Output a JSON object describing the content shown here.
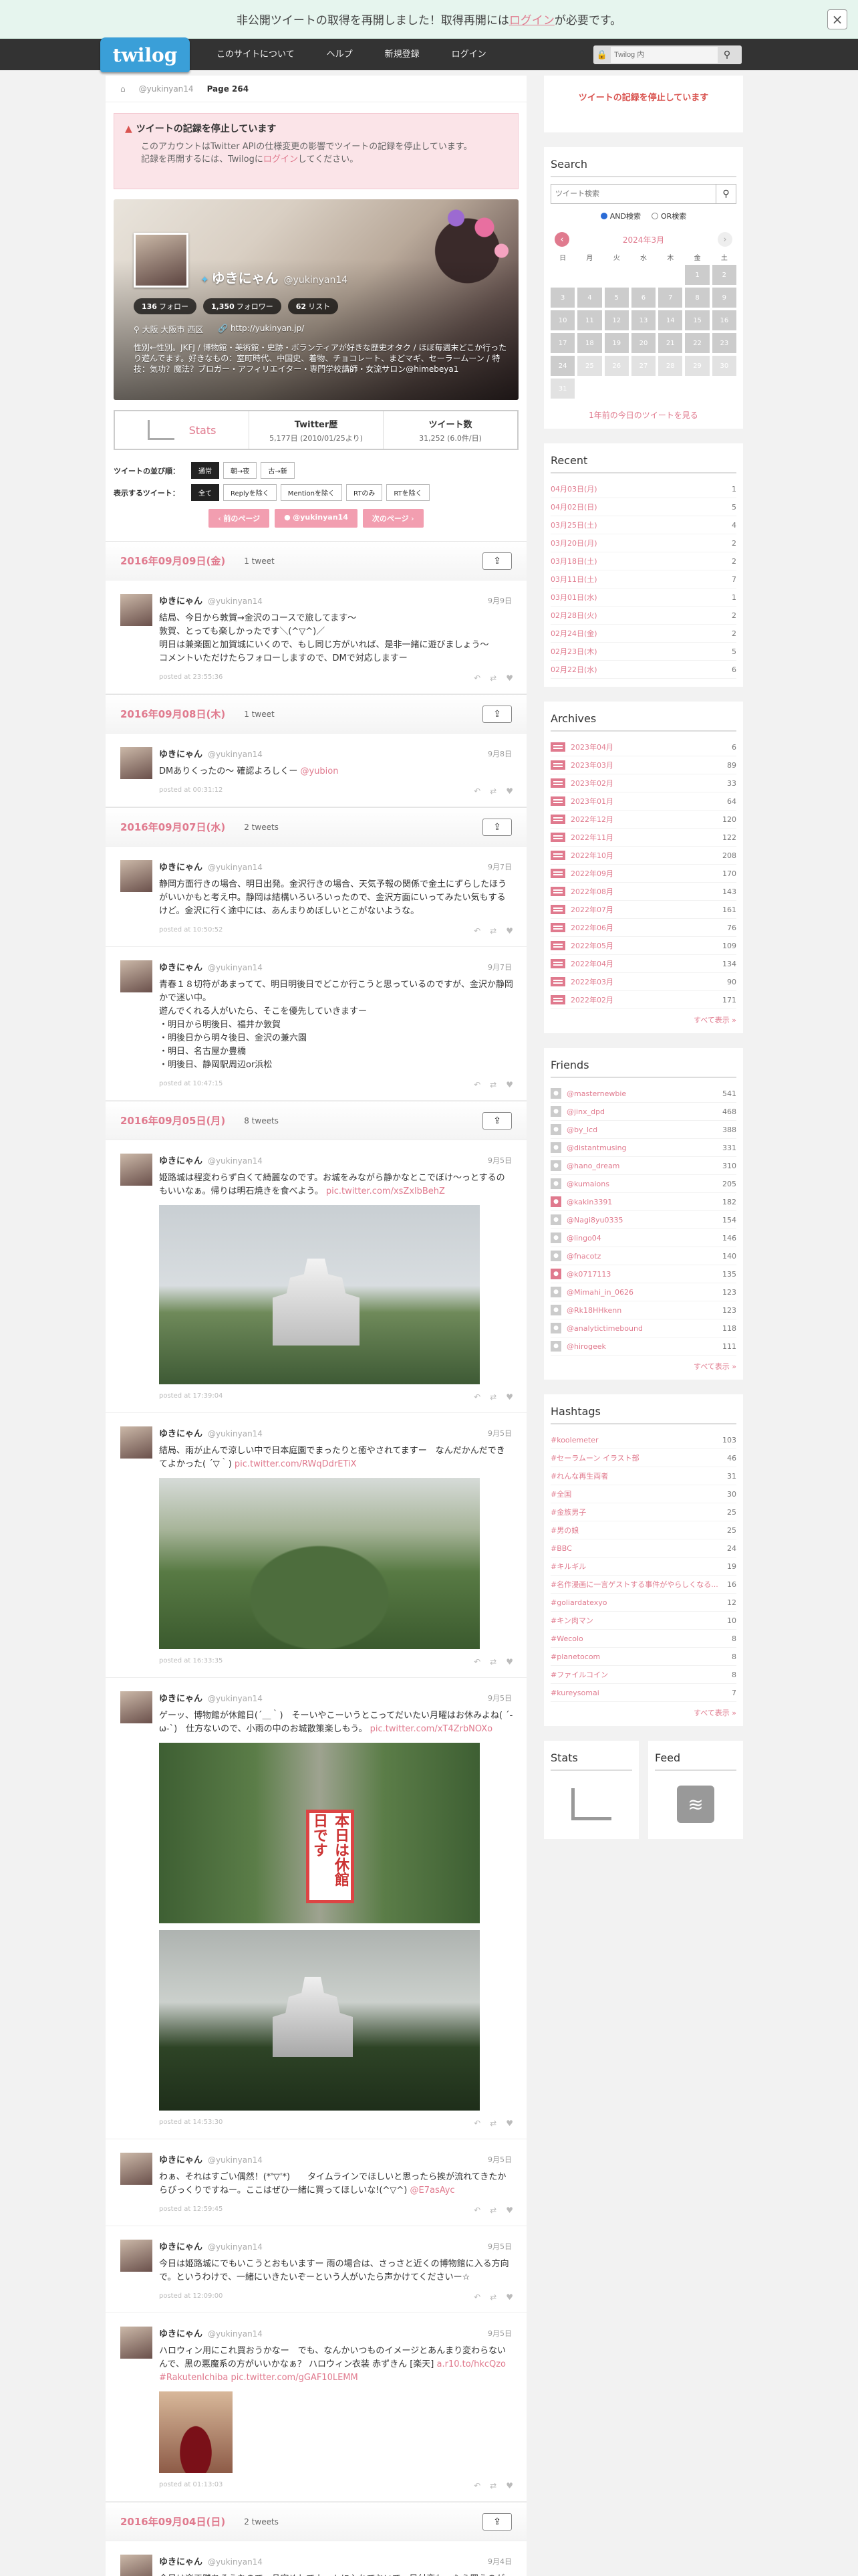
{
  "notice": {
    "text_before": "非公開ツイートの取得を再開しました！取得再開には",
    "link": "ログイン",
    "text_after": "が必要です。",
    "close": "×"
  },
  "header": {
    "logo": "twilog",
    "nav": [
      "このサイトについて",
      "ヘルプ",
      "新規登録",
      "ログイン"
    ],
    "search_placeholder": "Twilog 内",
    "search_icon": "search-icon"
  },
  "breadcrumb": {
    "user": "@yukinyan14",
    "page": "Page 264"
  },
  "warning": {
    "title": "ツイートの記録を停止しています",
    "line1": "このアカウントはTwitter APIの仕様変更の影響でツイートの記録を停止しています。",
    "line2_before": "記録を再開するには、Twilogに",
    "line2_link": "ログイン",
    "line2_after": "してください。"
  },
  "profile": {
    "name": "ゆきにゃん",
    "handle": "@yukinyan14",
    "follow": "136",
    "follow_label": "フォロー",
    "follower": "1,350",
    "follower_label": "フォロワー",
    "list": "62",
    "list_label": "リスト",
    "location": "大阪 大阪市 西区",
    "url": "http://yukinyan.jp/",
    "bio": "性別←性別。JKFJ / 博物館・美術館・史跡・ボランティアが好きな歴史オタク / ほぼ毎週末どこか行ったり遊んでます。好きなもの：室町時代、中国史、着物、チョコレート、まどマギ、セーラームーン / 特技：気功？魔法？ブロガー・アフィリエイター・専門学校講師・女流サロン@himebeya1"
  },
  "stats": {
    "label": "Stats",
    "twitter_title": "Twitter歴",
    "twitter_value": "5,177日",
    "twitter_since": "(2010/01/25より)",
    "tweets_title": "ツイート数",
    "tweets_value": "31,252",
    "tweets_per": "(6.0件/日)"
  },
  "selectors": {
    "order_label": "ツイートの並び順：",
    "order": [
      "通常",
      "朝→夜",
      "古→新"
    ],
    "filter_label": "表示するツイート：",
    "filter": [
      "全て",
      "Replyを除く",
      "Mentionを除く",
      "RTのみ",
      "RTを除く"
    ]
  },
  "pager": [
    "前のページ",
    "@yukinyan14",
    "次のページ"
  ],
  "days": [
    {
      "date": "2016年09月09日(金)",
      "count": "1 tweet",
      "tweets": [
        {
          "name": "ゆきにゃん",
          "handle": "@yukinyan14",
          "time": "9月9日",
          "text": "結局、今日から敦賀→金沢のコースで旅してます〜\n敦賀、とっても楽しかったです＼(^▽^)／\n明日は兼楽園と加賀城にいくので、もし同じ方がいれば、是非一緒に遊びましょう〜\nコメントいただけたらフォローしますので、DMで対応しますー",
          "link": "",
          "posted": "posted at 23:55:36"
        }
      ]
    },
    {
      "date": "2016年09月08日(木)",
      "count": "1 tweet",
      "tweets": [
        {
          "name": "ゆきにゃん",
          "handle": "@yukinyan14",
          "time": "9月8日",
          "text": "DMありくったの〜 確認よろしくー",
          "link": "@yubion",
          "posted": "posted at 00:31:12"
        }
      ]
    },
    {
      "date": "2016年09月07日(水)",
      "count": "2 tweets",
      "tweets": [
        {
          "name": "ゆきにゃん",
          "handle": "@yukinyan14",
          "time": "9月7日",
          "text": "静岡方面行きの場合、明日出発。金沢行きの場合、天気予報の関係で金土にずらしたほうがいいかもと考え中。静岡は結構いろいろいったので、金沢方面にいってみたい気もするけど。金沢に行く途中には、あんまりめぼしいとこがないような。",
          "link": "",
          "posted": "posted at 10:50:52"
        },
        {
          "name": "ゆきにゃん",
          "handle": "@yukinyan14",
          "time": "9月7日",
          "text": "青春１８切符があまってて、明日明後日でどこか行こうと思っているのですが、金沢か静岡かで迷い中。\n遊んでくれる人がいたら、そこを優先していきますー\n・明日から明後日、福井か敦賀\n・明後日から明々後日、金沢の兼六園\n・明日、名古屋か豊橋\n・明後日、静岡駅周辺or浜松",
          "link": "",
          "posted": "posted at 10:47:15"
        }
      ]
    },
    {
      "date": "2016年09月05日(月)",
      "count": "8 tweets",
      "tweets": [
        {
          "name": "ゆきにゃん",
          "handle": "@yukinyan14",
          "time": "9月5日",
          "text": "姫路城は程変わらず白くて綺麗なのです。お城をみながら静かなとこでぼけ〜っとするのもいいなぁ。帰りは明石焼きを食べよう。",
          "link": "pic.twitter.com/xsZxlbBehZ",
          "posted": "posted at 17:39:04"
        },
        {
          "name": "ゆきにゃん",
          "handle": "@yukinyan14",
          "time": "9月5日",
          "text": "結局、雨が止んで涼しい中で日本庭園でまったりと癒やされてますー　なんだかんだできてよかった( ´▽｀)",
          "link": "pic.twitter.com/RWqDdrETiX",
          "posted": "posted at 16:33:35"
        },
        {
          "name": "ゆきにゃん",
          "handle": "@yukinyan14",
          "time": "9月5日",
          "text": "ゲーッ、博物館が休館日(´＿｀)　そーいやこーいうとこってだいたい月曜はお休みよね( ´-ω-`)　仕方ないので、小雨の中のお城散策楽しもう。",
          "link": "pic.twitter.com/xT4ZrbNOXo",
          "posted": "posted at 14:53:30"
        },
        {
          "name": "ゆきにゃん",
          "handle": "@yukinyan14",
          "time": "9月5日",
          "text": "わぁ、それはすごい偶然！(*'▽'*)　　タイムラインでほしいと思ったら挨が流れてきたからびっくりですねー。ここはぜひ一緒に買ってほしいな!(^▽^)",
          "link": "@E7asAyc",
          "posted": "posted at 12:59:45"
        },
        {
          "name": "ゆきにゃん",
          "handle": "@yukinyan14",
          "time": "9月5日",
          "text": "今日は姫路城にでもいこうとおもいますー 雨の場合は、さっさと近くの博物館に入る方向で。というわけで、一緒にいきたいぞーという人がいたら声かけてくださいー☆",
          "link": "",
          "posted": "posted at 12:09:00"
        },
        {
          "name": "ゆきにゃん",
          "handle": "@yukinyan14",
          "time": "9月5日",
          "text": "ハロウィン用にこれ買おうかなー　でも、なんかいつものイメージとあんまり変わらないんで、黒の悪魔系の方がいいかなぁ？ ハロウィン衣装 赤ずきん [楽天]",
          "link": "a.r10.to/hkcQzo #RakutenIchiba pic.twitter.com/gGAF10LEMM",
          "posted": "posted at 01:13:03"
        }
      ]
    },
    {
      "date": "2016年09月04日(日)",
      "count": "2 tweets",
      "tweets": [
        {
          "name": "ゆきにゃん",
          "handle": "@yukinyan14",
          "time": "9月4日",
          "text": "今日は楽天勝ちそうなので、品定めしてカートに入れておいて、日付変わったら買うのが懸命かな。しかし、１０店舗も買いまわりできるかというとビミョーではあ",
          "link": "",
          "posted": ""
        }
      ]
    }
  ],
  "photos": {
    "sign_text": "本日は休館日です"
  },
  "side": {
    "stopped": "ツイートの記録を停止しています",
    "search_title": "Search",
    "search_placeholder": "ツイート検索",
    "and": "AND検索",
    "or": "OR検索",
    "cal_month": "2024年3月",
    "weekdays": [
      "日",
      "月",
      "火",
      "水",
      "木",
      "金",
      "土"
    ],
    "days": [
      "",
      "",
      "",
      "",
      "",
      "1",
      "2",
      "3",
      "4",
      "5",
      "6",
      "7",
      "8",
      "9",
      "10",
      "11",
      "12",
      "13",
      "14",
      "15",
      "16",
      "17",
      "18",
      "19",
      "20",
      "21",
      "22",
      "23",
      "24",
      "25",
      "26",
      "27",
      "28",
      "29",
      "30",
      "31"
    ],
    "year_link": "1年前の今日のツイートを見る",
    "recent_title": "Recent",
    "recent": [
      [
        "04月03日(月)",
        "1"
      ],
      [
        "04月02日(日)",
        "5"
      ],
      [
        "03月25日(土)",
        "4"
      ],
      [
        "03月20日(月)",
        "2"
      ],
      [
        "03月18日(土)",
        "2"
      ],
      [
        "03月11日(土)",
        "7"
      ],
      [
        "03月01日(水)",
        "1"
      ],
      [
        "02月28日(火)",
        "2"
      ],
      [
        "02月24日(金)",
        "2"
      ],
      [
        "02月23日(木)",
        "5"
      ],
      [
        "02月22日(水)",
        "6"
      ]
    ],
    "archives_title": "Archives",
    "archives": [
      [
        "2023年04月",
        "6"
      ],
      [
        "2023年03月",
        "89"
      ],
      [
        "2023年02月",
        "33"
      ],
      [
        "2023年01月",
        "64"
      ],
      [
        "2022年12月",
        "120"
      ],
      [
        "2022年11月",
        "122"
      ],
      [
        "2022年10月",
        "208"
      ],
      [
        "2022年09月",
        "170"
      ],
      [
        "2022年08月",
        "143"
      ],
      [
        "2022年07月",
        "161"
      ],
      [
        "2022年06月",
        "76"
      ],
      [
        "2022年05月",
        "109"
      ],
      [
        "2022年04月",
        "134"
      ],
      [
        "2022年03月",
        "90"
      ],
      [
        "2022年02月",
        "171"
      ]
    ],
    "more": "すべて表示 »",
    "friends_title": "Friends",
    "friends": [
      [
        "@masternewbie",
        "541"
      ],
      [
        "@jinx_dpd",
        "468"
      ],
      [
        "@by_lcd",
        "388"
      ],
      [
        "@distantmusing",
        "331"
      ],
      [
        "@hano_dream",
        "310"
      ],
      [
        "@kumaions",
        "205"
      ],
      [
        "@kakin3391",
        "182"
      ],
      [
        "@Nagi8yu0335",
        "154"
      ],
      [
        "@lingo04",
        "146"
      ],
      [
        "@fnacotz",
        "140"
      ],
      [
        "@k0717113",
        "135"
      ],
      [
        "@Mimahi_in_0626",
        "123"
      ],
      [
        "@Rk18HHkenn",
        "123"
      ],
      [
        "@analytictimebound",
        "118"
      ],
      [
        "@hirogeek",
        "111"
      ]
    ],
    "hashtags_title": "Hashtags",
    "hashtags": [
      [
        "#koolemeter",
        "103"
      ],
      [
        "#セーラムーン イラスト部",
        "46"
      ],
      [
        "#れんな再生両者",
        "31"
      ],
      [
        "#全国",
        "30"
      ],
      [
        "#金族男子",
        "25"
      ],
      [
        "#男の娘",
        "25"
      ],
      [
        "#BBC",
        "24"
      ],
      [
        "#キルギル",
        "19"
      ],
      [
        "#名作漫画に一言ゲストする事件がやらしくなる...",
        "16"
      ],
      [
        "#goliardatexyo",
        "12"
      ],
      [
        "#キン肉マン",
        "10"
      ],
      [
        "#Wecolo",
        "8"
      ],
      [
        "#planetocom",
        "8"
      ],
      [
        "#ファイルコイン",
        "8"
      ],
      [
        "#kureysomai",
        "7"
      ]
    ],
    "stats_title": "Stats",
    "feed_title": "Feed"
  },
  "colors": {
    "accent": "#e07a8e",
    "header": "#333333",
    "logo": "#3a9fd8"
  }
}
